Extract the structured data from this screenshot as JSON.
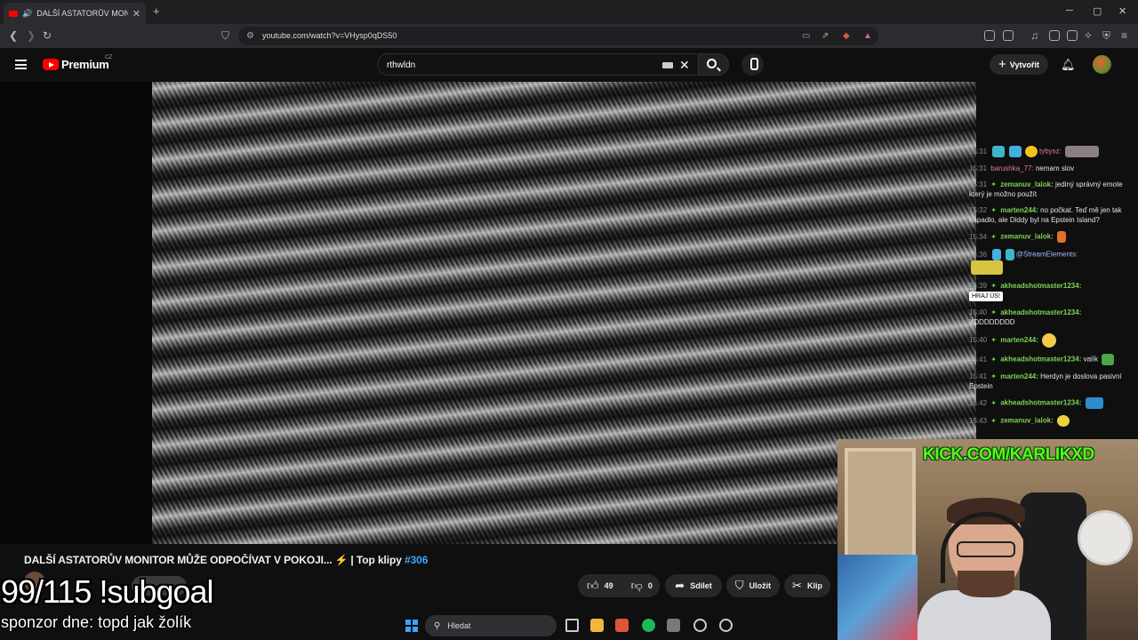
{
  "browser": {
    "tab_title": "DALŠÍ ASTATORŮV MONITOR",
    "tab_close": "✕",
    "new_tab": "+",
    "url": "youtube.com/watch?v=VHysp0qDS50"
  },
  "youtube": {
    "brand": "Premium",
    "region": "CZ",
    "search_query": "rthwldn",
    "create_label": "Vytvořit"
  },
  "chat": {
    "messages": [
      {
        "time": "15:31",
        "user": "tybysz:",
        "text": ""
      },
      {
        "time": "15:31",
        "user": "barushka_77:",
        "text": "nemam slov"
      },
      {
        "time": "15:31",
        "user": "zemanuv_lalok:",
        "text": "jediný správný emote který je možno použít"
      },
      {
        "time": "15:32",
        "user": "marten244:",
        "text": "no počkat. Teď mě jen tak napadlo, ale Diddy byl na Epstein Island?"
      },
      {
        "time": "15:34",
        "user": "zemanuv_lalok:",
        "text": ""
      },
      {
        "time": "15:36",
        "user": "@StreamElements:",
        "text": ""
      },
      {
        "time": "15:39",
        "user": "akheadshotmaster1234:",
        "text": "HRAJ ÚS!"
      },
      {
        "time": "15:40",
        "user": "akheadshotmaster1234:",
        "text": "XDDDDDDDD"
      },
      {
        "time": "15:40",
        "user": "marten244:",
        "text": ""
      },
      {
        "time": "15:41",
        "user": "akheadshotmaster1234:",
        "text": "valík"
      },
      {
        "time": "15:41",
        "user": "marten244:",
        "text": "Herdyn je doslova pasivní Epstein"
      },
      {
        "time": "15:42",
        "user": "akheadshotmaster1234:",
        "text": ""
      },
      {
        "time": "15:43",
        "user": "zemanuv_lalok:",
        "text": ""
      }
    ]
  },
  "webcam": {
    "kick_url": "KICK.COM/KARLIKXD"
  },
  "video": {
    "title": "DALŠÍ ASTATORŮV MONITOR MŮŽE ODPOČÍVAT V POKOJI...",
    "bolt": "⚡",
    "series": "| Top klipy",
    "tag": "#306",
    "likes": "49",
    "dislikes": "0",
    "share_label": "Sdílet",
    "save_label": "Uložit",
    "clip_label": "Klip"
  },
  "overlay": {
    "subgoal": "99/115 !subgoal",
    "sponsor": "sponzor dne: topd jak žolík"
  },
  "taskbar": {
    "search_label": "Hledat"
  }
}
